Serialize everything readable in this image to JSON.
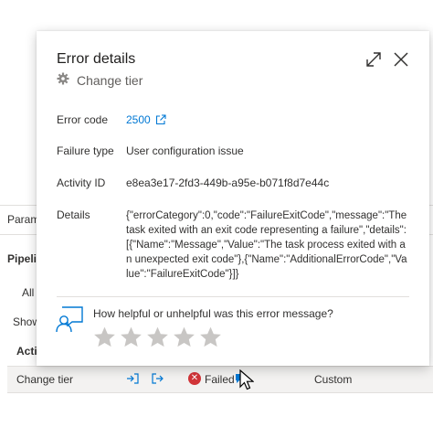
{
  "background": {
    "params_label": "Param",
    "pipelines_label": "Pipeli",
    "all_label": "All",
    "show_label": "Show",
    "activity_label": "Acti",
    "row": {
      "name": "Change tier",
      "status": "Failed",
      "type": "Custom"
    }
  },
  "popup": {
    "title": "Error details",
    "subtitle": "Change tier",
    "fields": {
      "error_code_label": "Error code",
      "error_code_value": "2500",
      "failure_type_label": "Failure type",
      "failure_type_value": "User configuration issue",
      "activity_id_label": "Activity ID",
      "activity_id_value": "e8ea3e17-2fd3-449b-a95e-b071f8d7e44c",
      "details_label": "Details",
      "details_value": "{\"errorCategory\":0,\"code\":\"FailureExitCode\",\"message\":\"The task exited with an exit code representing a failure\",\"details\":[{\"Name\":\"Message\",\"Value\":\"The task process exited with an unexpected exit code\"},{\"Name\":\"AdditionalErrorCode\",\"Value\":\"FailureExitCode\"}]}"
    },
    "feedback": {
      "question": "How helpful or unhelpful was this error message?",
      "rating": 0,
      "max_rating": 5
    }
  },
  "colors": {
    "accent": "#0078d4",
    "error": "#d13438",
    "star_empty": "#c8c6c4"
  },
  "icons": [
    "expand-icon",
    "close-icon",
    "gear-icon",
    "external-link-icon",
    "feedback-icon",
    "star-icon",
    "error-icon",
    "cursor-icon"
  ]
}
